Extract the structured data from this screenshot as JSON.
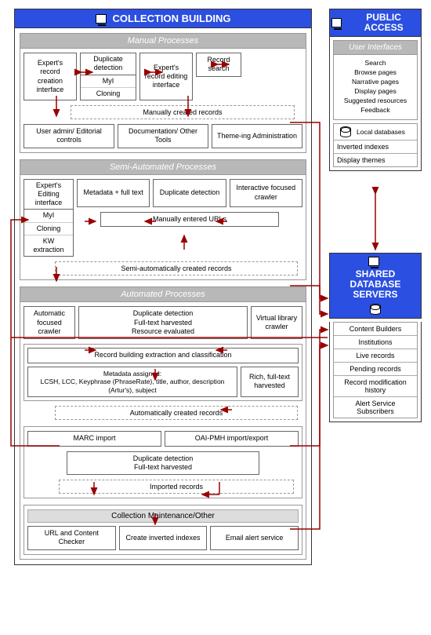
{
  "collection_building": {
    "title": "COLLECTION BUILDING",
    "manual": {
      "title": "Manual Processes",
      "creation_iface": "Expert's record creation interface",
      "dup_detect": "Duplicate detection",
      "myi": "MyI",
      "cloning": "Cloning",
      "editing_iface": "Expert's record editing interface",
      "record_search": "Record search",
      "created_records": "Manually created records",
      "user_admin": "User admin/ Editorial controls",
      "documentation": "Documentation/ Other Tools",
      "theming": "Theme-ing Administration"
    },
    "semi": {
      "title": "Semi-Automated Processes",
      "editing_iface": "Expert's Editing interface",
      "myi": "MyI",
      "cloning": "Cloning",
      "kw_extract": "KW extraction",
      "metadata": "Metadata + full text",
      "dup_detect": "Duplicate detection",
      "crawler": "Interactive focused crawler",
      "urls": "Manually entered URLs",
      "created_records": "Semi-automatically created records"
    },
    "auto": {
      "title": "Automated Processes",
      "auto_crawler": "Automatic focused crawler",
      "dup_fulltext_eval": "Duplicate detection\nFull-text harvested\nResource evaluated",
      "virtual_crawler": "Virtual library crawler",
      "record_building": "Record building extraction and classification",
      "metadata_assigned": "Metadata assigned:\nLCSH, LCC, Keyphrase (PhraseRate), title, author, description (Artur's), subject",
      "rich_fulltext": "Rich, full-text harvested",
      "created_records": "Automatically created records",
      "marc": "MARC import",
      "oai": "OAI-PMH import/export",
      "dup_fulltext": "Duplicate detection\nFull-text harvested",
      "imported": "Imported records",
      "maint_title": "Collection Maintenance/Other",
      "url_checker": "URL and Content Checker",
      "create_indexes": "Create inverted indexes",
      "email_alert": "Email alert service"
    }
  },
  "public_access": {
    "title": "PUBLIC ACCESS",
    "ui_title": "User Interfaces",
    "search": "Search",
    "browse": "Browse pages",
    "narrative": "Narrative pages",
    "display": "Display pages",
    "suggested": "Suggested resources",
    "feedback": "Feedback",
    "local_db": "Local databases",
    "inverted": "Inverted indexes",
    "themes": "Display themes"
  },
  "shared": {
    "title": "SHARED DATABASE SERVERS",
    "content_builders": "Content Builders",
    "institutions": "Institutions",
    "live_records": "Live records",
    "pending": "Pending records",
    "history": "Record modification history",
    "alert": "Alert Service Subscribers"
  }
}
